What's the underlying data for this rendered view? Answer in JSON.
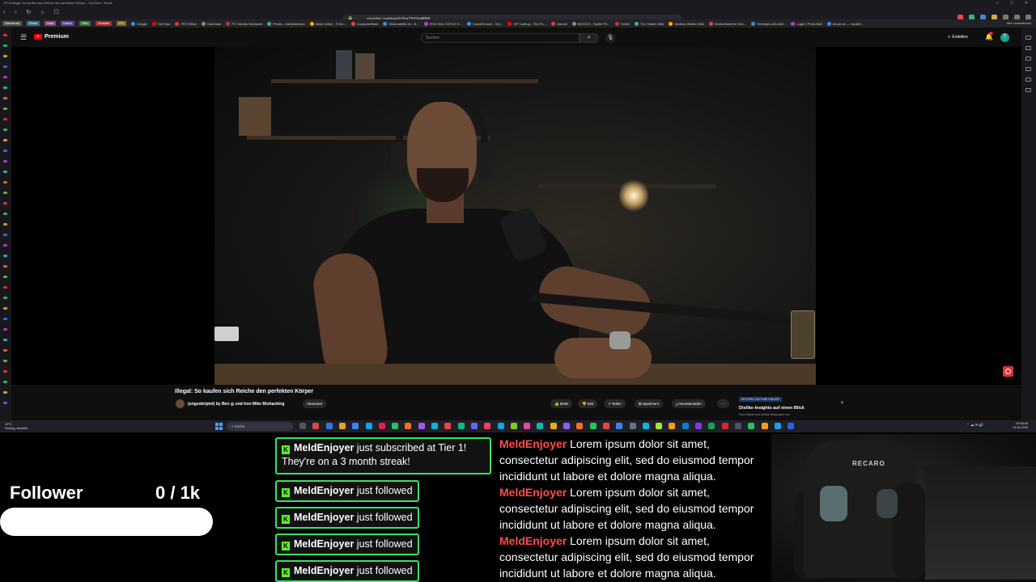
{
  "browser": {
    "window_title": "TR Is illegal: So kaufen sich Reiche den perfekten Körper - YouTube - Brave",
    "url": "youtube.com/watch?v=7TsDjoAPNI",
    "bookmarks_chips": [
      {
        "label": "Nachleute",
        "color": "#555"
      },
      {
        "label": "Reise",
        "color": "#3a6d8c"
      },
      {
        "label": "Mail",
        "color": "#8a4a8a"
      },
      {
        "label": "Twitch",
        "color": "#6441a5"
      },
      {
        "label": "Plex",
        "color": "#3d7a3d"
      },
      {
        "label": "Youtube",
        "color": "#b03030"
      },
      {
        "label": "PH",
        "color": "#8a6d1a"
      }
    ],
    "bookmarks": [
      "Google",
      "YouTube",
      "FRITZ!Box",
      "Gamestar",
      "PC Games Hardware",
      "Preise - Hardwareluxx",
      "heise online - IT-Ne...",
      "ComputerBase",
      "Diskmodelle.de - N...",
      "ROG Strix X570-E G...",
      "CrazyDrLoom - NG...",
      "VIP Ludbug - The Po...",
      "Uphold",
      "WOOCO - Spiele Pe...",
      "Twitch",
      "The Hidden Wiki",
      "Another Hidden Wiki",
      "Deutschland im Des...",
      "Terminpro-info Akti...",
      "Login | Proto-Mail",
      "About us — LocalM..."
    ],
    "bookmarks_all": "Alle Lesezeichen"
  },
  "youtube": {
    "logo": "Premium",
    "search_placeholder": "Suchen",
    "create": "Erstellen",
    "bell_badge": "9+",
    "avatar_letter": "T",
    "video_title": "Illegal: So kaufen sich Reiche den perfekten Körper",
    "channel": "(ungeskriptet) by Ben ◎ und Iron Mike Biohacking",
    "subscribed": "Abonniert",
    "likes": "9045",
    "comments": "540",
    "share": "Teilen",
    "save": "Speichern",
    "download": "Herunterladen",
    "more": "···",
    "rd_tag": "RETURN YOUTUBE DISLIKE",
    "rd_title": "Dislike-Insights auf einen Blick",
    "rd_sub": "Rob Dislikes und direkte Meldungen von"
  },
  "taskbar": {
    "weather_temp": "19°C",
    "weather_desc": "Sonnig, bewölkt",
    "search": "Suche",
    "time": "02:58:45",
    "date": "19.04.2026"
  },
  "overlay": {
    "follower_label": "Follower",
    "follower_count": "0 / 1k",
    "follower_progress": 0,
    "alerts": [
      {
        "user": "MeldEnjoyer",
        "text": " just subscribed at Tier 1!",
        "line2": "They're on a 3 month streak!"
      },
      {
        "user": "MeldEnjoyer",
        "text": " just followed"
      },
      {
        "user": "MeldEnjoyer",
        "text": " just followed"
      },
      {
        "user": "MeldEnjoyer",
        "text": " just followed"
      },
      {
        "user": "MeldEnjoyer",
        "text": " just followed"
      }
    ],
    "chat": [
      {
        "user": "MeldEnjoyer",
        "text": " Lorem ipsum dolor sit amet, consectetur adipiscing elit, sed do eiusmod tempor incididunt ut labore et dolore magna aliqua."
      },
      {
        "user": "MeldEnjoyer",
        "text": " Lorem ipsum dolor sit amet, consectetur adipiscing elit, sed do eiusmod tempor incididunt ut labore et dolore magna aliqua."
      },
      {
        "user": "MeldEnjoyer",
        "text": " Lorem ipsum dolor sit amet, consectetur adipiscing elit, sed do eiusmod tempor incididunt ut labore et dolore magna aliqua."
      }
    ],
    "webcam_brand": "RECARO"
  },
  "colors": {
    "accent_green": "#3adf67",
    "kick_green": "#53fc18",
    "chat_user_red": "#ff4b4b",
    "youtube_red": "#ff0000"
  }
}
